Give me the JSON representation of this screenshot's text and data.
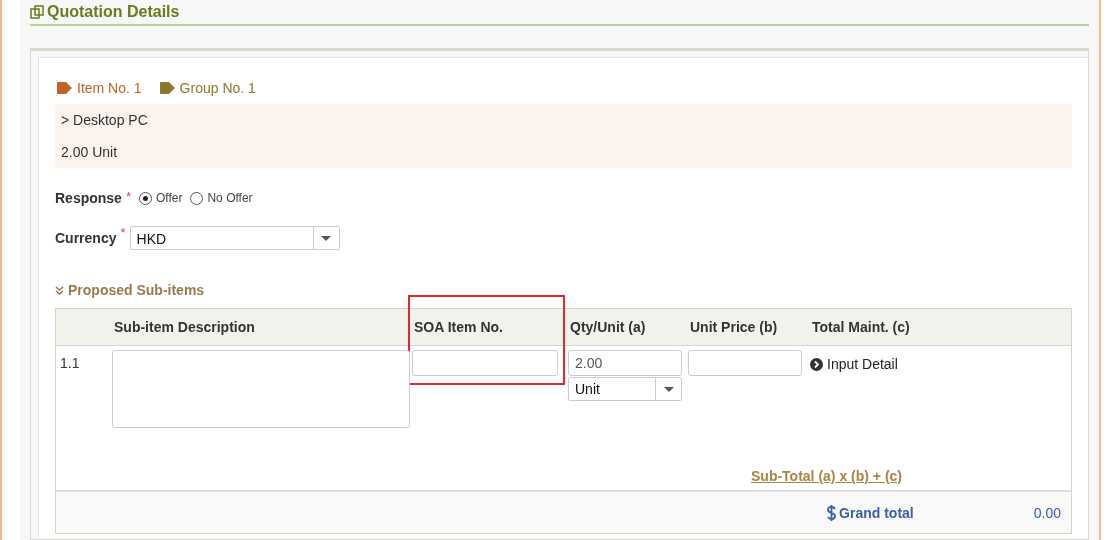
{
  "section": {
    "title": "Quotation Details"
  },
  "tags": [
    {
      "label": "Item No. 1",
      "color": "#c0622a"
    },
    {
      "label": "Group No. 1",
      "color": "#8a7a2a"
    }
  ],
  "item": {
    "name": "> Desktop PC",
    "quantity": "2.00 Unit"
  },
  "response": {
    "label": "Response",
    "required_mark": "*",
    "options": [
      {
        "label": "Offer",
        "selected": true
      },
      {
        "label": "No Offer",
        "selected": false
      }
    ]
  },
  "currency": {
    "label": "Currency",
    "required_mark": "*",
    "value": "HKD"
  },
  "subitems": {
    "title": "Proposed Sub-items",
    "columns": [
      {
        "label": "Sub-item Description",
        "highlighted": false
      },
      {
        "label": "SOA Item No.",
        "highlighted": true
      },
      {
        "label": "Qty/Unit (a)",
        "highlighted": false
      },
      {
        "label": "Unit Price (b)",
        "highlighted": false
      },
      {
        "label": "Total Maint. (c)",
        "highlighted": false
      }
    ],
    "rows": [
      {
        "number": "1.1",
        "description": "",
        "soa": "",
        "qty": "2.00",
        "unit": "Unit",
        "price": "",
        "detail": "Input Detail"
      }
    ],
    "subtotal_label": "Sub-Total (a) x (b) + (c)",
    "grand_total_label": "Grand total",
    "grand_total": "0.00"
  }
}
